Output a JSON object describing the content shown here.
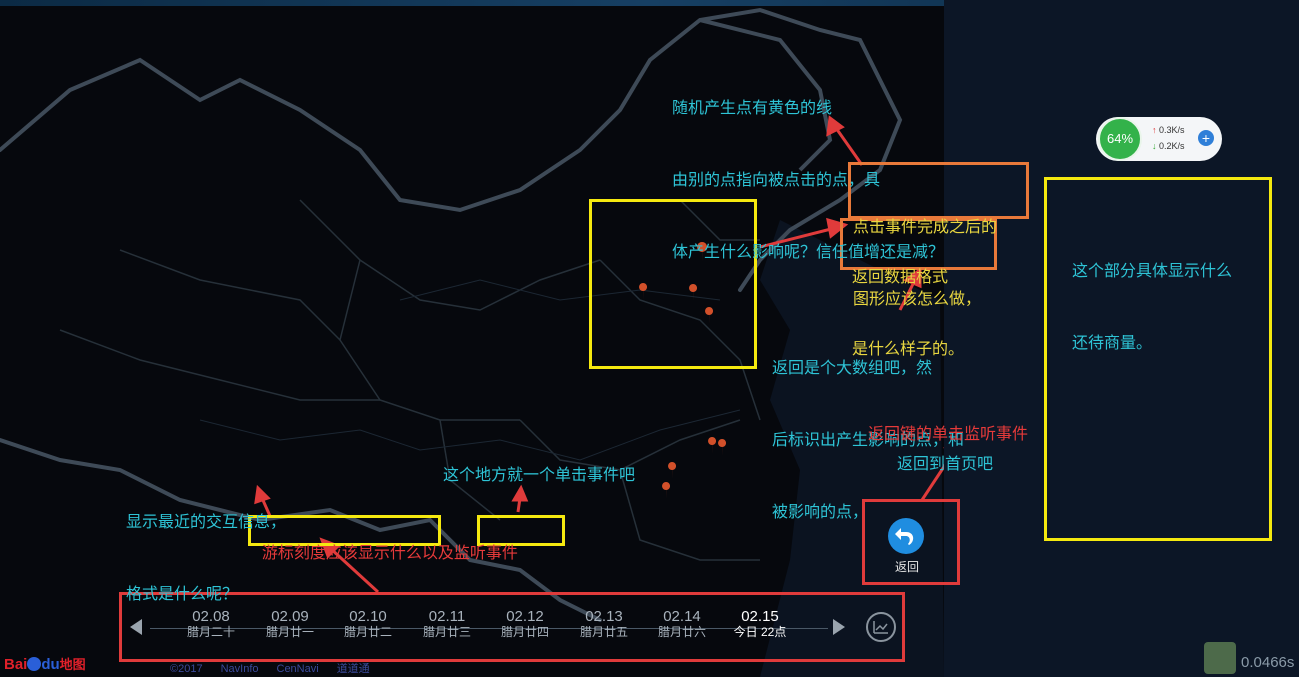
{
  "annotations": {
    "top_note": [
      "随机产生点有黄色的线",
      "由别的点指向被点击的点，具",
      "体产生什么影响呢？信任值增还是减？"
    ],
    "click_done": [
      "点击事件完成之后的",
      "图形应该怎么做，"
    ],
    "return_format": [
      "返回数据格式",
      "是什么样子的。"
    ],
    "return_array": [
      "返回是个大数组吧，然",
      "后标识出产生影响的点，和",
      "被影响的点，"
    ],
    "right_panel": [
      "这个部分具体显示什么",
      "还待商量。"
    ],
    "back_listen": "返回键的单击监听事件",
    "back_home": "返回到首页吧",
    "recent_info": [
      "显示最近的交互信息，",
      "格式是什么呢？"
    ],
    "single_click": "这个地方就一个单击事件吧",
    "cursor_scale_part1": "游标刻度应该显示什么以及",
    "cursor_scale_part2": "监听事件"
  },
  "network_widget": {
    "percent": "64%",
    "up": "0.3K/s",
    "down": "0.2K/s",
    "add": "+"
  },
  "back_button": {
    "label": "返回"
  },
  "timeline": {
    "items": [
      {
        "date": "02.08",
        "lunar": "腊月二十"
      },
      {
        "date": "02.09",
        "lunar": "腊月廿一"
      },
      {
        "date": "02.10",
        "lunar": "腊月廿二"
      },
      {
        "date": "02.11",
        "lunar": "腊月廿三"
      },
      {
        "date": "02.12",
        "lunar": "腊月廿四"
      },
      {
        "date": "02.13",
        "lunar": "腊月廿五"
      },
      {
        "date": "02.14",
        "lunar": "腊月廿六"
      },
      {
        "date": "02.15",
        "lunar": "今日 22点"
      }
    ]
  },
  "brand": {
    "bai": "Bai",
    "du": "du",
    "map": "地图"
  },
  "credits": [
    "©2017",
    "NavInfo",
    "CenNavi",
    "道道通"
  ],
  "timer": "0.0466s",
  "colors": {
    "accent": "#2ec4d6",
    "alert": "#e63a3a",
    "highlight": "#f5e90f",
    "orange": "#e8793a"
  }
}
